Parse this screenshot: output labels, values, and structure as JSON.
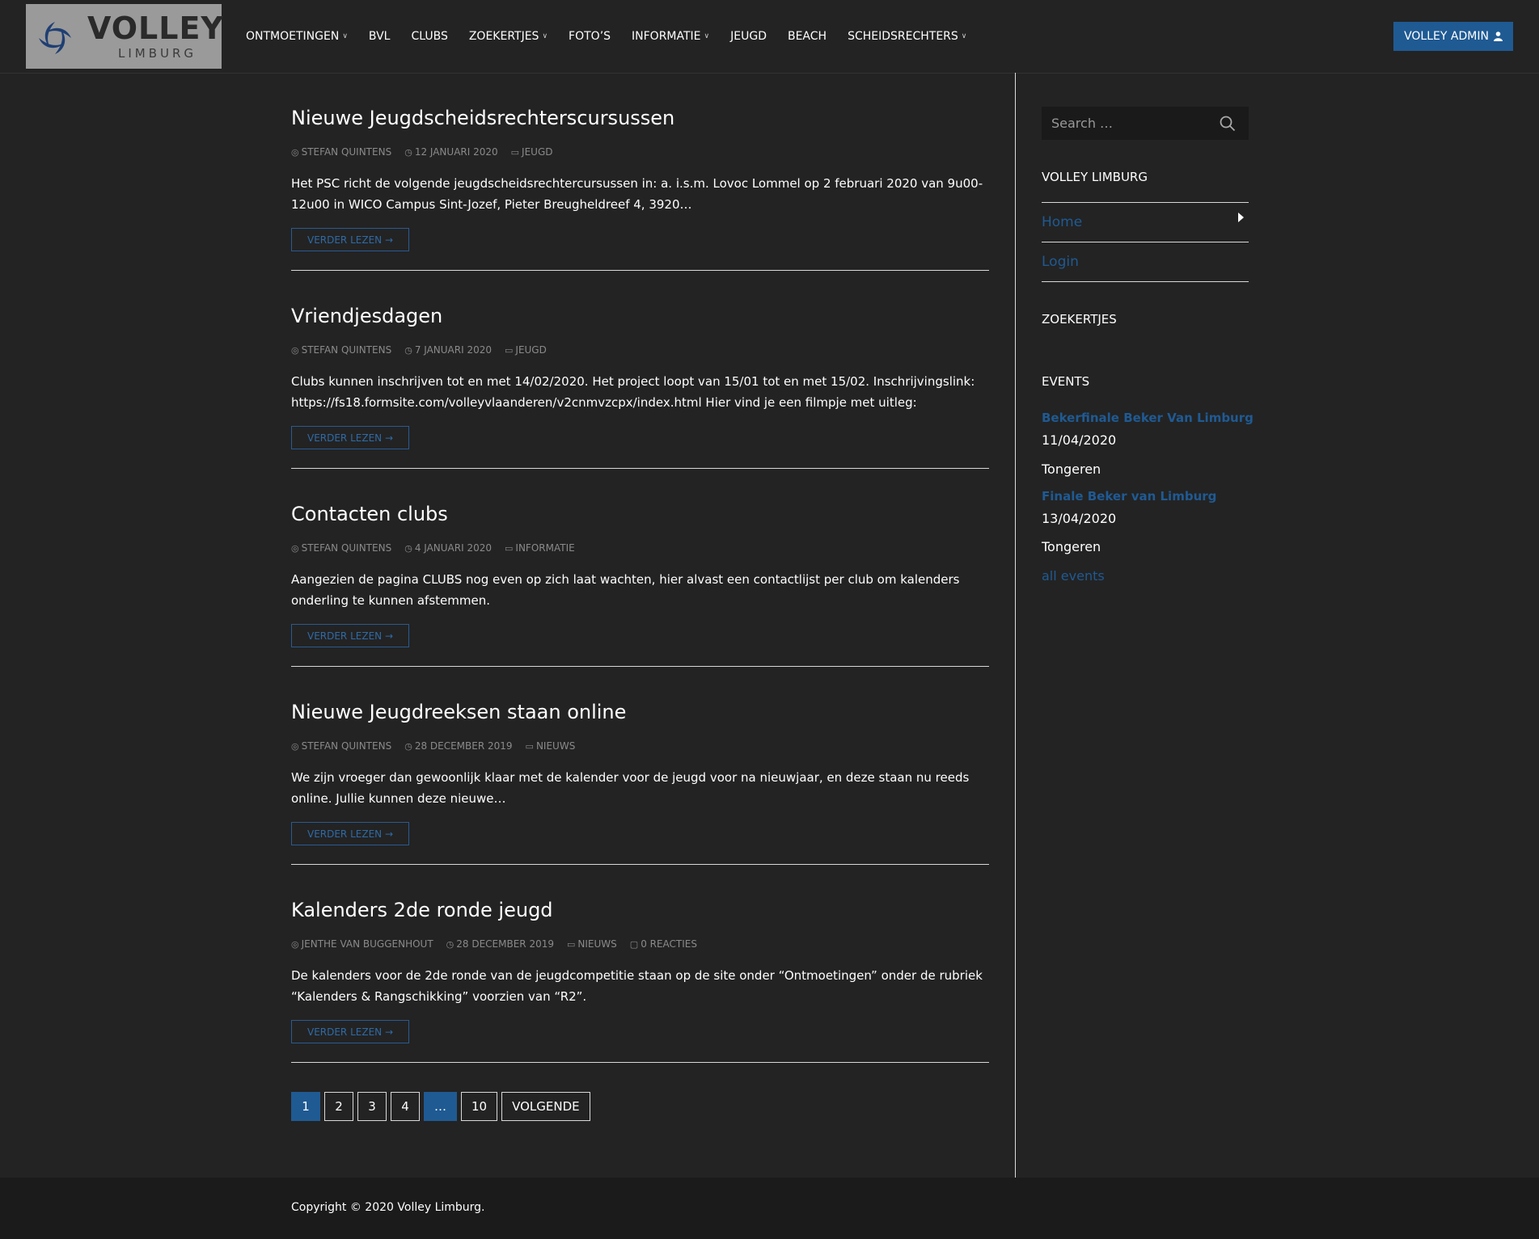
{
  "brand": {
    "name": "VOLLEY",
    "sub": "LIMBURG"
  },
  "nav": {
    "items": [
      {
        "label": "ONTMOETINGEN",
        "dropdown": true
      },
      {
        "label": "BVL",
        "dropdown": false
      },
      {
        "label": "CLUBS",
        "dropdown": false
      },
      {
        "label": "ZOEKERTJES",
        "dropdown": true
      },
      {
        "label": "FOTO’S",
        "dropdown": false
      },
      {
        "label": "INFORMATIE",
        "dropdown": true
      },
      {
        "label": "JEUGD",
        "dropdown": false
      },
      {
        "label": "BEACH",
        "dropdown": false
      },
      {
        "label": "SCHEIDSRECHTERS",
        "dropdown": true
      }
    ],
    "admin_label": "VOLLEY ADMIN"
  },
  "posts": [
    {
      "title": "Nieuwe Jeugdscheidsrechterscursussen",
      "author": "STEFAN QUINTENS",
      "date": "12 JANUARI 2020",
      "category": "JEUGD",
      "excerpt": "Het PSC richt de volgende jeugdscheidsrechtercursussen in: a. i.s.m. Lovoc Lommel op 2 februari 2020 van 9u00-12u00 in WICO Campus Sint-Jozef, Pieter Breugheldreef 4, 3920…",
      "more": "VERDER LEZEN →"
    },
    {
      "title": "Vriendjesdagen",
      "author": "STEFAN QUINTENS",
      "date": "7 JANUARI 2020",
      "category": "JEUGD",
      "excerpt": "Clubs kunnen inschrijven tot en met 14/02/2020. Het project loopt van 15/01 tot en met 15/02. Inschrijvingslink: https://fs18.formsite.com/volleyvlaanderen/v2cnmvzcpx/index.html Hier vind je een filmpje met uitleg:",
      "more": "VERDER LEZEN →"
    },
    {
      "title": "Contacten clubs",
      "author": "STEFAN QUINTENS",
      "date": "4 JANUARI 2020",
      "category": "INFORMATIE",
      "excerpt": "Aangezien de pagina CLUBS nog even op zich laat wachten, hier alvast een contactlijst per club om kalenders onderling te kunnen afstemmen.",
      "more": "VERDER LEZEN →"
    },
    {
      "title": "Nieuwe Jeugdreeksen staan online",
      "author": "STEFAN QUINTENS",
      "date": "28 DECEMBER 2019",
      "category": "NIEUWS",
      "excerpt": "We zijn vroeger dan gewoonlijk klaar met de kalender voor de jeugd voor na nieuwjaar, en deze staan nu reeds online. Jullie kunnen deze nieuwe…",
      "more": "VERDER LEZEN →"
    },
    {
      "title": "Kalenders 2de ronde jeugd",
      "author": "JENTHE VAN BUGGENHOUT",
      "date": "28 DECEMBER 2019",
      "category": "NIEUWS",
      "comments": "0 REACTIES",
      "excerpt": "De kalenders voor de 2de ronde van de jeugdcompetitie staan op de site onder “Ontmoetingen” onder de rubriek “Kalenders & Rangschikking” voorzien van “R2”.",
      "more": "VERDER LEZEN →"
    }
  ],
  "pagination": [
    "1",
    "2",
    "3",
    "4",
    "…",
    "10",
    "VOLGENDE"
  ],
  "sidebar": {
    "search_placeholder": "Search …",
    "widget1_title": "VOLLEY LIMBURG",
    "menu": [
      "Home",
      "Login"
    ],
    "widget2_title": "ZOEKERTJES",
    "widget3_title": "EVENTS",
    "events": [
      {
        "title": "Bekerfinale Beker Van Limburg",
        "date": "11/04/2020",
        "location": "Tongeren"
      },
      {
        "title": "Finale Beker van Limburg",
        "date": "13/04/2020",
        "location": "Tongeren"
      }
    ],
    "all_events": "all events"
  },
  "footer": {
    "copyright": "Copyright © 2020 Volley Limburg."
  },
  "colors": {
    "accent": "#1f5a93",
    "background": "#232323",
    "footer": "#1b1b1b"
  }
}
